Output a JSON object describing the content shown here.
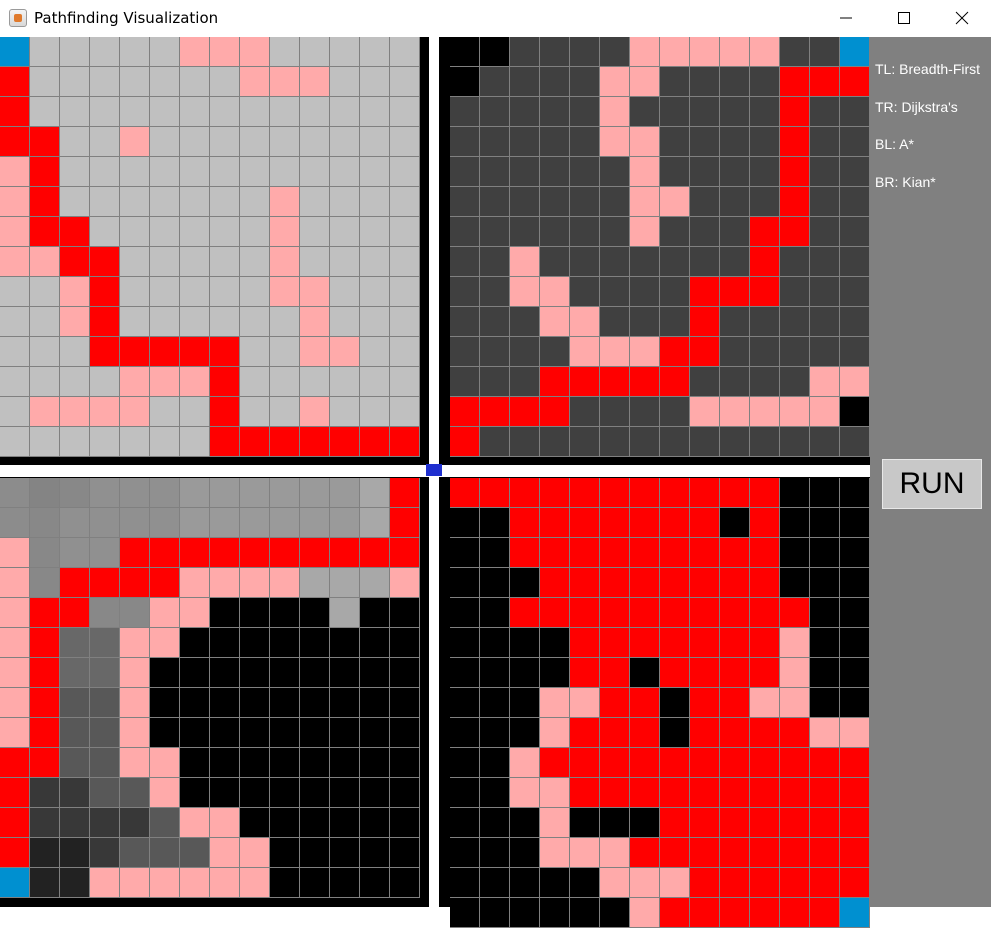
{
  "window": {
    "title": "Pathfinding Visualization",
    "controls": [
      "minimize-icon",
      "maximize-icon",
      "close-icon"
    ]
  },
  "sidebar": {
    "labels": [
      {
        "key": "tl",
        "text": "TL: Breadth-First"
      },
      {
        "key": "tr",
        "text": "TR: Dijkstra's"
      },
      {
        "key": "bl",
        "text": "BL: A*"
      },
      {
        "key": "br",
        "text": "BR: Kian*"
      }
    ],
    "run_label": "RUN"
  },
  "colors": {
    "path": "#ff0000",
    "visited": "#ffaaaa",
    "endpoint": "#0090d0",
    "wall": "#000000",
    "grid_line": "#808080",
    "bfs_unvisited": "#c0c0c0",
    "dijkstra_unvisited": "#404040",
    "kian_unvisited": "#000000"
  },
  "quadrants": [
    {
      "name": "breadth-first",
      "position": "top-left",
      "rows": [
        "SGGGGGVVVGGGGG",
        "RGGGGGGGVVVGGG",
        "RGGGGGGGGGGGGG",
        "RRGGVGGGGGGGGG",
        "VRGGGGGGGGGGGG",
        "VRGGGGGGGVGGGG",
        "VRRGGGGGGVGGGG",
        "VVRRGGGGGVGGGG",
        "GGVRGGGGGVVGGG",
        "GGVRGGGGGGVGGG",
        "GGGRRRRRGGVVGG",
        "GGGGVVVRGGGGGG",
        "GVVVVGGRGGVGGG",
        "GGGGGGGRRRRRRR"
      ]
    },
    {
      "name": "dijkstra",
      "position": "top-right",
      "rows": [
        "WWDDDDVVVVVDDS",
        "WDDDDVVDDDDRRR",
        "DDDDDVDDDDDRDD",
        "DDDDDVVDDDDRDD",
        "DDDDDDVDDDDRDD",
        "DDDDDDVVDDDRDD",
        "DDDDDDVDDDRRDD",
        "DDVDDDDDDDRDDD",
        "DDVVDDDDRRRDDD",
        "DDDVVDDDRDDDDD",
        "DDDDVVVRRDDDDD",
        "DDDRRRRRDDDDVV",
        "RRRRDDDDVVVVVW",
        "RDDDDDDDDDDDDD"
      ]
    },
    {
      "name": "a-star",
      "position": "bottom-left",
      "rows": [
        "1234445555556R",
        "1344445555556R",
        "V344RRRRRRRRRR",
        "V3RRRRVVVV666V",
        "VRR33VVWWWW6WW",
        "VR77VVWWWWWWWW",
        "VR77VWWWWWWWWW",
        "VR88VWWWWWWWWW",
        "VR88VWWWWWWWWW",
        "RR88VVWWWWWWWW",
        "R9988VWWWWWWWW",
        "R99998VVWWWWWW",
        "RAA9888VVWWWWW",
        "SAAVVVVVVWWWWW"
      ]
    },
    {
      "name": "kian",
      "position": "bottom-right",
      "rows": [
        "RRRRRRRRRRRKKK",
        "KKRRRRRRRKRKKK",
        "KKRRRRRRRRRKKK",
        "KKKRRRRRRRRKKK",
        "KKRRRRRRRRRRKK",
        "KKKKRRRRRRRVKK",
        "KKKKRRKRRRRVKK",
        "KKKVVRRKRRVVKK",
        "KKKVRRRKRRRRVV",
        "KKVRRRRRRRRRRR",
        "KKVVRRRRRRRRRR",
        "KKKVKKKRRRRRRR",
        "KKKVVVRRRRRRRR",
        "KKKKKVVVRRRRRR",
        "KKKKKKVRRRRRRS"
      ]
    }
  ]
}
